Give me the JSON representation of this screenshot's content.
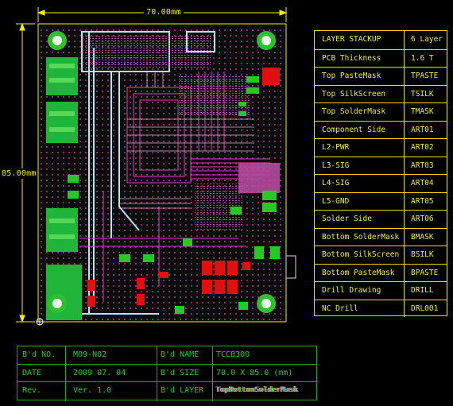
{
  "dimensions": {
    "width_label": "70.00mm",
    "height_label": "85.00mm"
  },
  "stackup": {
    "rows": [
      {
        "name": "LAYER STACKUP",
        "value": "6 Layer"
      },
      {
        "name": "PCB Thickness",
        "value": "1.6 T"
      },
      {
        "name": "Top PasteMask",
        "value": "TPASTE"
      },
      {
        "name": "Top SilkScreen",
        "value": "TSILK"
      },
      {
        "name": "Top SolderMask",
        "value": "TMASK"
      },
      {
        "name": "Component Side",
        "value": "ART01"
      },
      {
        "name": "L2-PWR",
        "value": "ART02"
      },
      {
        "name": "L3-SIG",
        "value": "ART03"
      },
      {
        "name": "L4-SIG",
        "value": "ART04"
      },
      {
        "name": "L5-GND",
        "value": "ART05"
      },
      {
        "name": "Solder Side",
        "value": "ART06"
      },
      {
        "name": "Bottom SolderMask",
        "value": "BMASK"
      },
      {
        "name": "Bottom SilkScreen",
        "value": "BSILK"
      },
      {
        "name": "Bottom PasteMask",
        "value": "BPASTE"
      },
      {
        "name": "Drill Drawing",
        "value": "DRILL"
      },
      {
        "name": "NC Drill",
        "value": "DRL001"
      }
    ]
  },
  "title_block": {
    "bd_no_label": "B'd NO.",
    "bd_no_value": "M09-N02",
    "bd_name_label": "B'd NAME",
    "bd_name_value": "TCCB300",
    "date_label": "DATE",
    "date_value": "2009 07. 04",
    "bd_size_label": "B'd SIZE",
    "bd_size_value": "70.0 X 85.0 (mm)",
    "rev_label": "Rev.",
    "rev_value": "Ver. 1.0",
    "bd_layer_label": "B'd LAYER",
    "bd_layer_value": "TopBottomSolderMask"
  },
  "colors": {
    "yellow": "#f5f000",
    "green": "#1bd11b",
    "magenta": "#e040c0",
    "pink": "#f6a0e8",
    "red": "#e01010",
    "cyan": "#a8e8f0",
    "board_bg": "#101010"
  }
}
